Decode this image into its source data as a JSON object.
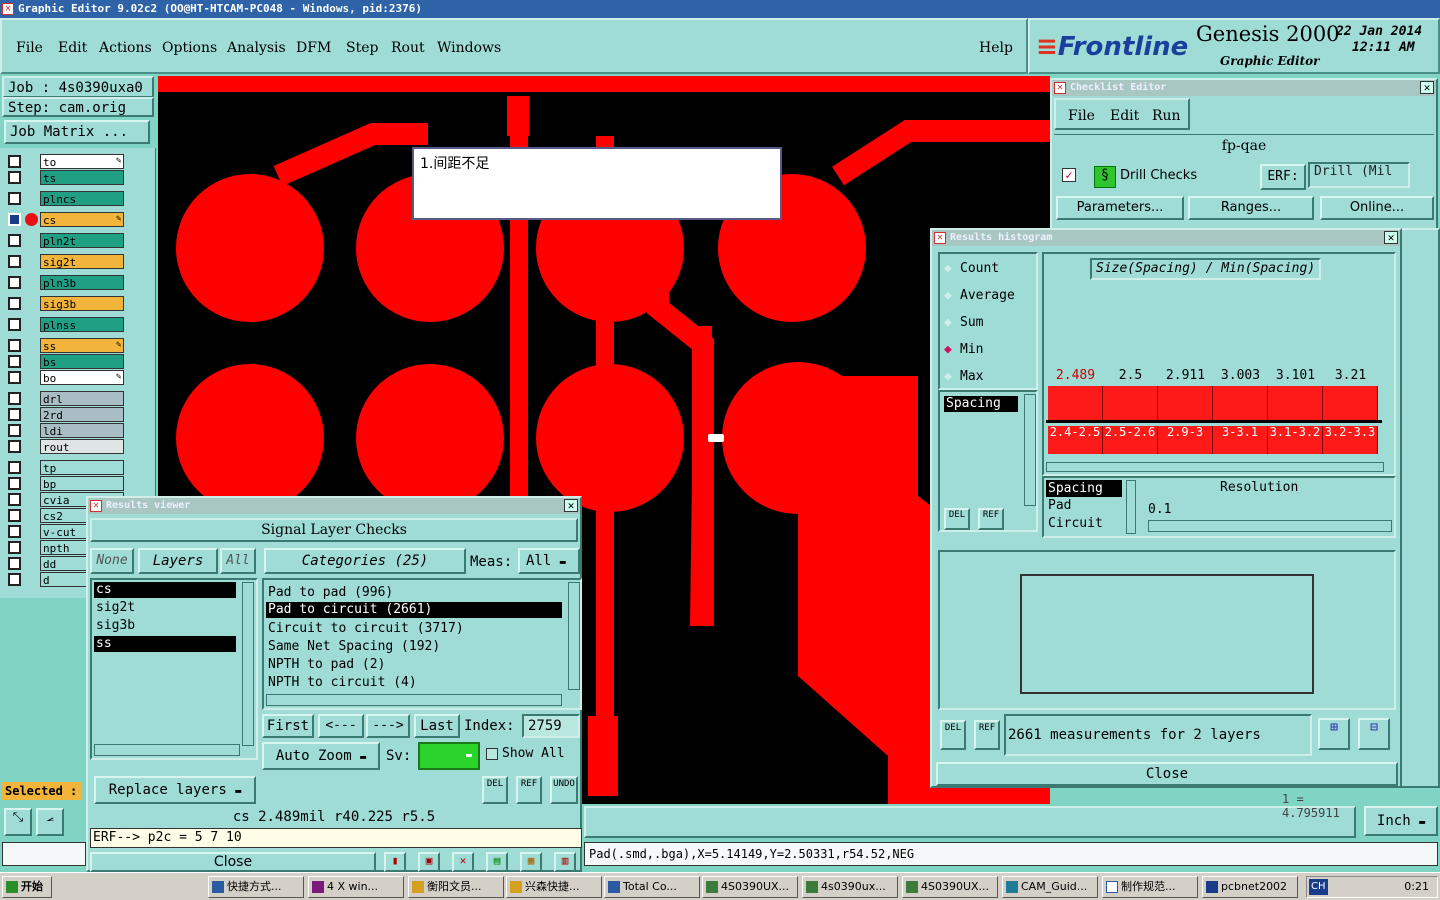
{
  "window": {
    "title": "Graphic Editor 9.02c2 (OO@HT-HTCAM-PC048 - Windows, pid:2376)"
  },
  "menu": [
    "File",
    "Edit",
    "Actions",
    "Options",
    "Analysis",
    "DFM",
    "Step",
    "Rout",
    "Windows"
  ],
  "help_label": "Help",
  "brand": {
    "logo": "Frontline",
    "product": "Genesis 2000",
    "subtitle": "Graphic Editor",
    "date": "22 Jan 2014",
    "time": "12:11 AM"
  },
  "job": {
    "job": "Job : 4s0390uxa0",
    "step": "Step: cam.orig",
    "matrix_button": "Job Matrix ..."
  },
  "layers": [
    {
      "name": "to",
      "color": "#ffffff",
      "mark": "edit"
    },
    {
      "name": "ts",
      "color": "#1f9f84",
      "mark": ""
    },
    {
      "name": "plncs",
      "color": "#1f9f84",
      "mark": ""
    },
    {
      "name": "cs",
      "color": "#f2b43a",
      "mark": "edit"
    },
    {
      "name": "pln2t",
      "color": "#1f9f84",
      "mark": ""
    },
    {
      "name": "sig2t",
      "color": "#f2b43a",
      "mark": ""
    },
    {
      "name": "pln3b",
      "color": "#1f9f84",
      "mark": ""
    },
    {
      "name": "sig3b",
      "color": "#f2b43a",
      "mark": ""
    },
    {
      "name": "plnss",
      "color": "#1f9f84",
      "mark": ""
    },
    {
      "name": "ss",
      "color": "#f2b43a",
      "mark": "edit"
    },
    {
      "name": "bs",
      "color": "#1f9f84",
      "mark": ""
    },
    {
      "name": "bo",
      "color": "#ffffff",
      "mark": "edit"
    },
    {
      "name": "drl",
      "color": "#a9bdc5",
      "mark": ""
    },
    {
      "name": "2rd",
      "color": "#a9bdc5",
      "mark": ""
    },
    {
      "name": "ldi",
      "color": "#a9bdc5",
      "mark": ""
    },
    {
      "name": "rout",
      "color": "#dfe4e4",
      "mark": ""
    },
    {
      "name": "tp",
      "color": "#9fdcd6",
      "mark": ""
    },
    {
      "name": "bp",
      "color": "#9fdcd6",
      "mark": ""
    },
    {
      "name": "cvia",
      "color": "#9fdcd6",
      "mark": ""
    },
    {
      "name": "cs2",
      "color": "#9fdcd6",
      "mark": ""
    },
    {
      "name": "v-cut",
      "color": "#9fdcd6",
      "mark": ""
    },
    {
      "name": "npth",
      "color": "#9fdcd6",
      "mark": ""
    },
    {
      "name": "dd",
      "color": "#9fdcd6",
      "mark": ""
    },
    {
      "name": "d",
      "color": "#9fdcd6",
      "mark": ""
    }
  ],
  "selected_label": "Selected :",
  "annotation": "1.间距不足",
  "checklist": {
    "title": "Checklist Editor",
    "menu": [
      "File",
      "Edit",
      "Run"
    ],
    "name": "fp-qae",
    "check_name": "Drill Checks",
    "erf_label": "ERF:",
    "erf_value": "Drill (Mil",
    "buttons": [
      "Parameters...",
      "Ranges...",
      "Online..."
    ]
  },
  "histogram": {
    "title": "Results histogram",
    "options": [
      "Count",
      "Average",
      "Sum",
      "Min",
      "Max"
    ],
    "selected_option": "Min",
    "list": [
      "Spacing"
    ],
    "chart_title": "Size(Spacing) / Min(Spacing)",
    "bins": [
      "2.4-2.5",
      "2.5-2.6",
      "2.9-3",
      "3-3.1",
      "3.1-3.2",
      "3.2-3.3"
    ],
    "values": [
      "2.489",
      "2.5",
      "2.911",
      "3.003",
      "3.101",
      "3.21"
    ],
    "type_list": [
      "Spacing",
      "Pad",
      "Circuit"
    ],
    "resolution_label": "Resolution",
    "resolution_value": "0.1",
    "summary": "2661 measurements for 2 layers",
    "close": "Close",
    "del": "DEL",
    "ref": "REF"
  },
  "viewer": {
    "title": "Results viewer",
    "header": "Signal Layer Checks",
    "none": "None",
    "layers": "Layers",
    "all": "All",
    "categories": "Categories (25)",
    "meas_label": "Meas:",
    "meas_value": "All",
    "layer_list": [
      "cs",
      "sig2t",
      "sig3b",
      "ss"
    ],
    "category_list": [
      "Pad to pad (996)",
      "Pad to circuit (2661)",
      "Circuit to circuit (3717)",
      "Same Net Spacing (192)",
      "NPTH to pad (2)",
      "NPTH to circuit (4)"
    ],
    "first": "First",
    "prev": "<---",
    "next": "--->",
    "last": "Last",
    "index_label": "Index:",
    "index_value": "2759",
    "auto_zoom": "Auto Zoom",
    "sv": "Sv:",
    "show_all": "Show All",
    "replace": "Replace layers",
    "undo": "UNDO",
    "status": "cs 2.489mil  r40.225  r5.5",
    "erf": "ERF--> p2c = 5 7 10",
    "close": "Close"
  },
  "units": "Inch",
  "coord_partial": "1 = 4.795911",
  "statusbar": "Pad(.smd,.bga),X=5.14149,Y=2.50331,r54.52,NEG",
  "taskbar": {
    "start": "开始",
    "items": [
      "快捷方式...",
      "4 X win...",
      "衡阳文员...",
      "兴森快捷...",
      "Total Co...",
      "4S0390UX...",
      "4s0390ux...",
      "4S0390UX...",
      "CAM_Guid...",
      "制作规范...",
      "pcbnet2002"
    ],
    "clock": "0:21",
    "lang": "CH"
  },
  "colors": {
    "copper": "#ff0000",
    "board": "#000000",
    "panel": "#9fdcd6"
  }
}
